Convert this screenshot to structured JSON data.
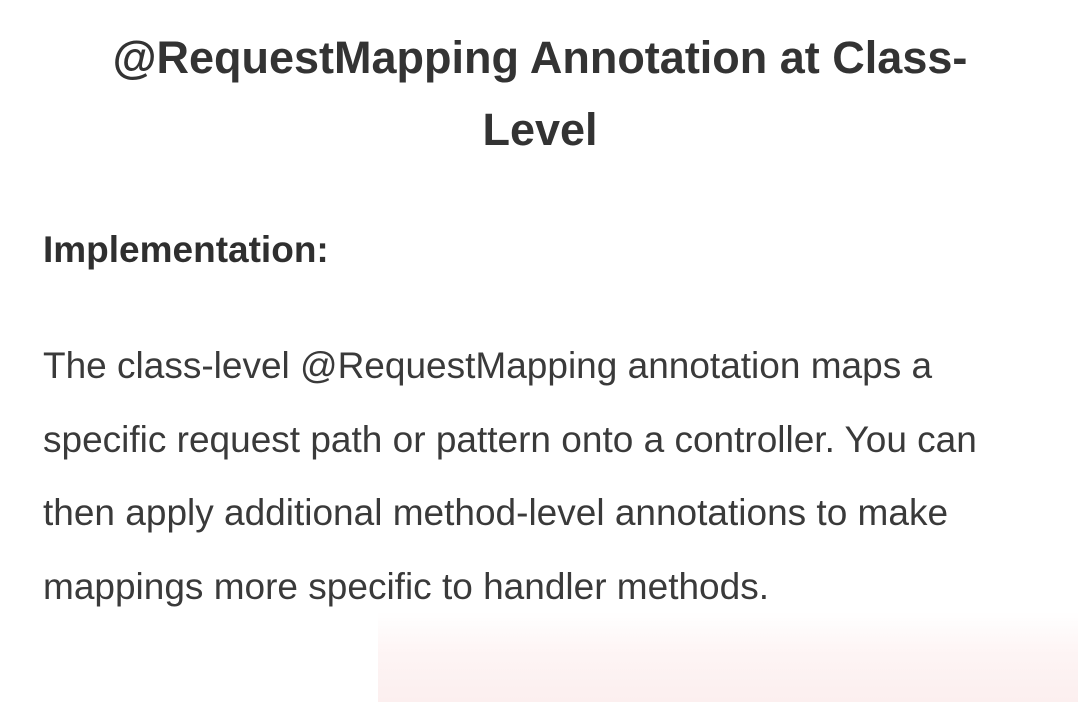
{
  "article": {
    "title": "@RequestMapping Annotation at Class-Level",
    "subheading": "Implementation:",
    "paragraph": "The class-level @RequestMapping annotation maps a specific request path or pattern onto a controller. You can then apply additional method-level annotations to make mappings more specific to handler methods."
  }
}
